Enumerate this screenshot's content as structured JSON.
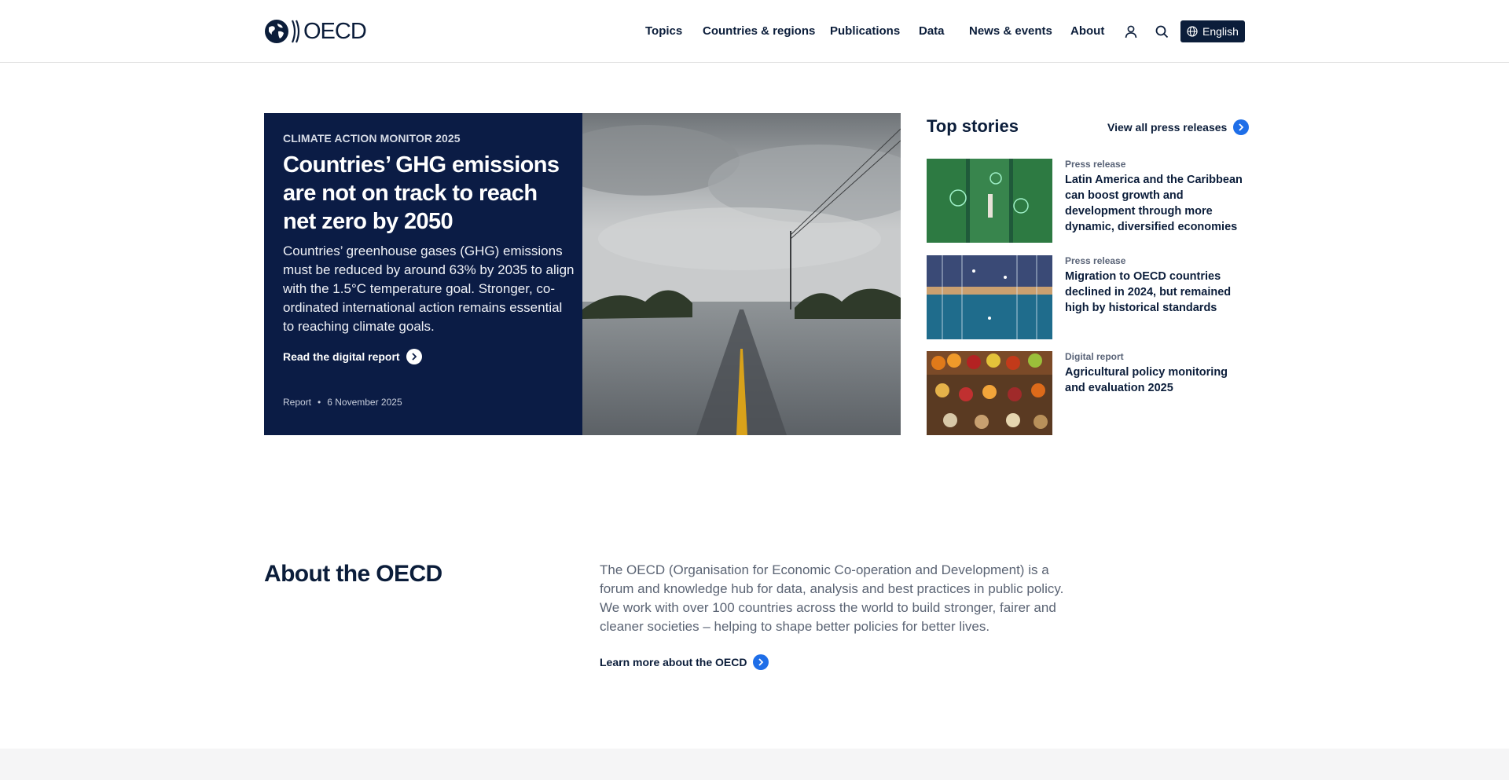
{
  "header": {
    "logo_text": "OECD",
    "nav": [
      "Topics",
      "Countries & regions",
      "Publications",
      "Data",
      "News & events",
      "About"
    ],
    "account_icon": "user-icon",
    "search_icon": "search-icon",
    "language": {
      "label": "English",
      "icon": "globe-icon"
    }
  },
  "hero": {
    "kicker": "CLIMATE ACTION MONITOR 2025",
    "title": "Countries’ GHG emissions are not on track to reach net zero by 2050",
    "description": "Countries’ greenhouse gases (GHG) emissions must be reduced by around 63% by 2035 to align with the 1.5°C temperature goal. Stronger, co-ordinated international action remains essential to reaching climate goals.",
    "link_label": "Read the digital report",
    "meta_type": "Report",
    "meta_date": "6 November 2025",
    "image": "flooded-road-photo"
  },
  "top_stories": {
    "title": "Top stories",
    "view_all": "View all press releases",
    "items": [
      {
        "type": "Press release",
        "title": "Latin America and the Caribbean can boost growth and development through more dynamic, diversified economies",
        "image": "vertical-farm-photo"
      },
      {
        "type": "Press release",
        "title": "Migration to OECD countries declined in 2024, but remained high by historical standards",
        "image": "connected-people-illustration"
      },
      {
        "type": "Digital report",
        "title": "Agricultural policy monitoring and evaluation 2025",
        "image": "produce-market-photo"
      }
    ]
  },
  "about": {
    "title": "About the OECD",
    "text": "The OECD (Organisation for Economic Co-operation and Development) is a forum and knowledge hub for data, analysis and best practices in public policy. We work with over 100 countries across the world to build stronger, fairer and cleaner societies – helping to shape better policies for better lives.",
    "link_label": "Learn more about the OECD"
  },
  "colors": {
    "navy": "#0b1c45",
    "accent_blue": "#1e6ee8",
    "text_dark": "#0b1d3a",
    "text_grey": "#5b6474"
  }
}
